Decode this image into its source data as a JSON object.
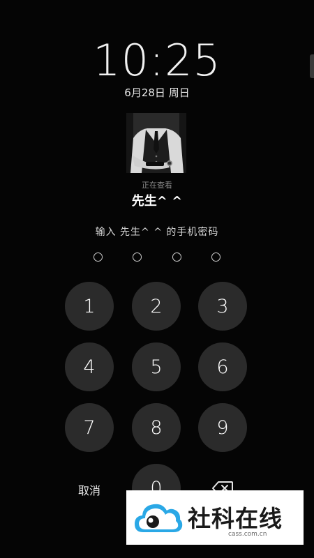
{
  "lock_screen": {
    "time": "10:25",
    "date": "6月28日 周日",
    "viewing_label": "正在查看",
    "owner_name": "先生^ ^",
    "prompt": "输入 先生^ ^ 的手机密码",
    "passcode_length": 4,
    "entered_digits": 0
  },
  "keypad": {
    "keys": [
      "1",
      "2",
      "3",
      "4",
      "5",
      "6",
      "7",
      "8",
      "9",
      "0"
    ],
    "cancel_label": "取消",
    "delete_icon": "backspace-icon"
  },
  "watermark": {
    "name": "社科在线",
    "url": "cass.com.cn"
  },
  "colors": {
    "background": "#050505",
    "key_fill": "#2b2b2b",
    "text": "#ffffff",
    "muted_text": "#8c8c8c",
    "watermark_blue": "#2aa8e6"
  }
}
